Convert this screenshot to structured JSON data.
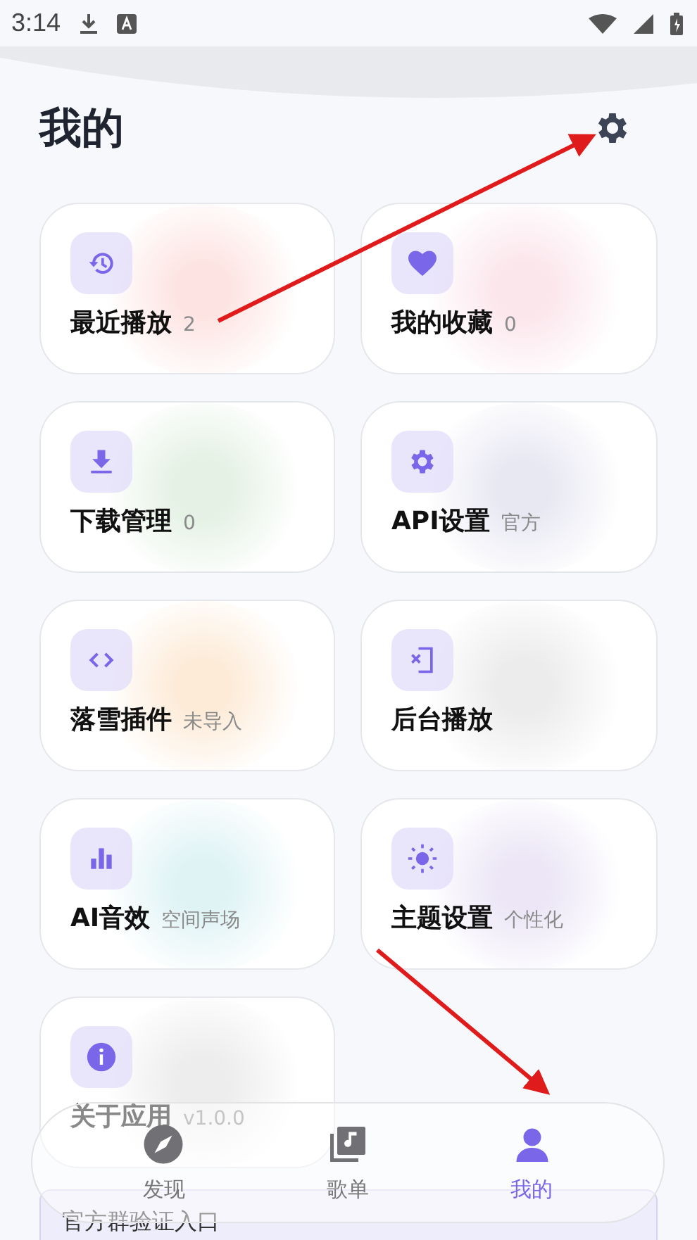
{
  "status_bar": {
    "time": "3:14"
  },
  "header": {
    "title": "我的"
  },
  "cards": [
    {
      "kind": "history",
      "label": "最近播放",
      "detail": "2",
      "color": "#fde4e2"
    },
    {
      "kind": "heart",
      "label": "我的收藏",
      "detail": "0",
      "color": "#fbe6ec"
    },
    {
      "kind": "download",
      "label": "下载管理",
      "detail": "0",
      "color": "#e4f1e4"
    },
    {
      "kind": "gear",
      "label": "API设置",
      "detail": "官方",
      "color": "#e8e8f3"
    },
    {
      "kind": "code",
      "label": "落雪插件",
      "detail": "未导入",
      "color": "#fdebd8"
    },
    {
      "kind": "exit",
      "label": "后台播放",
      "color": "#ececec"
    },
    {
      "kind": "chart",
      "label": "AI音效",
      "detail": "空间声场",
      "color": "#dff3f5"
    },
    {
      "kind": "sun",
      "label": "主题设置",
      "detail": "个性化",
      "color": "#ece6f6"
    },
    {
      "kind": "info",
      "label": "关于应用",
      "detail": "v1.0.0",
      "color": "#ededed"
    }
  ],
  "banner": {
    "text": "官方群验证入口"
  },
  "nav": [
    {
      "kind": "compass",
      "label": "发现",
      "selected": false
    },
    {
      "kind": "music",
      "label": "歌单",
      "selected": false
    },
    {
      "kind": "person",
      "label": "我的",
      "selected": true
    }
  ]
}
